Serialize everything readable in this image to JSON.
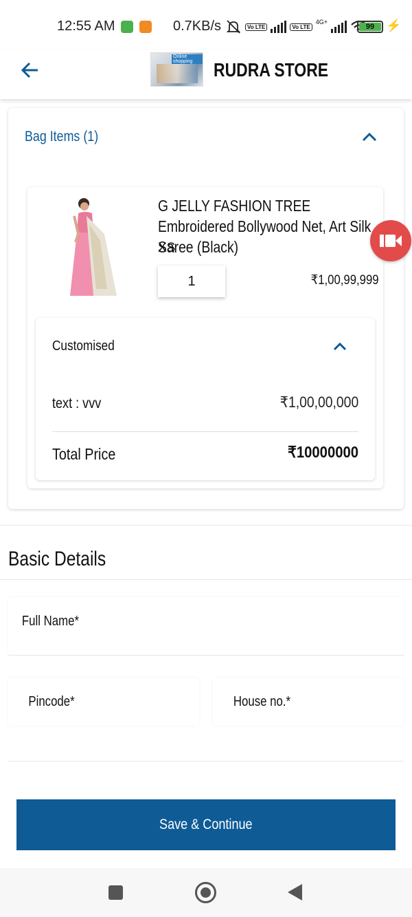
{
  "status_bar": {
    "time": "12:55 AM",
    "net_speed": "0.7KB/s",
    "volte_label": "Vo LTE",
    "network_label": "4G+",
    "battery": "99",
    "bolt_icon": "⚡"
  },
  "header": {
    "store_name": "RUDRA STORE",
    "logo_text": "Online shopping"
  },
  "bag": {
    "title": "Bag Items (1)",
    "item": {
      "name": "G JELLY FASHION TREE  Embroidered Bollywood Net, Art Silk Saree  (Black)",
      "size": "XS",
      "quantity": "1",
      "price": "₹1,00,99,999"
    },
    "customised": {
      "title": "Customised",
      "text_label": "text : vvv",
      "text_price": "₹1,00,00,000",
      "total_label": "Total Price",
      "total_value": "₹10000000"
    }
  },
  "basic_details": {
    "title": "Basic Details",
    "full_name_label": "Full Name*",
    "pincode_label": "Pincode*",
    "house_label": "House no.*"
  },
  "actions": {
    "save_label": "Save & Continue"
  },
  "colors": {
    "primary": "#0e5b96",
    "record": "#e34b4b",
    "battery": "#4cb34c"
  }
}
